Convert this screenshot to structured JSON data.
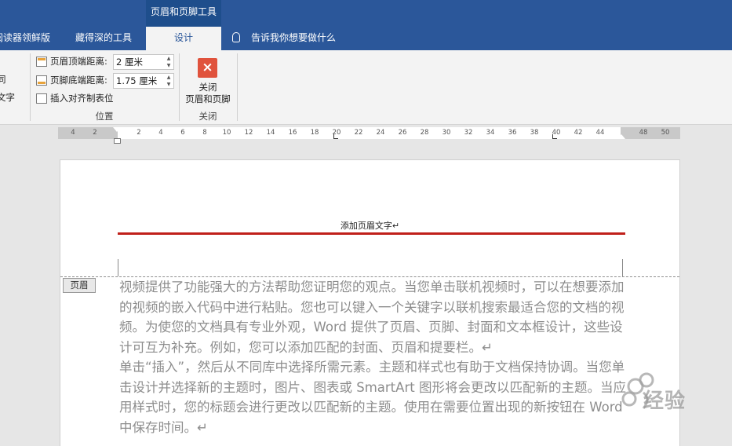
{
  "contextual_tab": {
    "label": "页眉和页脚工具"
  },
  "tabs": [
    {
      "label": "阅读器领鲜版"
    },
    {
      "label": "藏得深的工具"
    },
    {
      "label": "设计"
    }
  ],
  "tell_me": {
    "label": "告诉我你想要做什么"
  },
  "ribbon": {
    "left_partial": [
      "同",
      "文字"
    ],
    "position_group": {
      "header_top_label": "页眉顶端距离:",
      "header_top_value": "2 厘米",
      "footer_bottom_label": "页脚底端距离:",
      "footer_bottom_value": "1.75 厘米",
      "insert_align_tab_label": "插入对齐制表位",
      "group_label": "位置"
    },
    "close_group": {
      "button_line1": "关闭",
      "button_line2": "页眉和页脚",
      "group_label": "关闭"
    }
  },
  "ruler": {
    "left_ticks": [
      "4",
      "2"
    ],
    "right_ticks": [
      "2",
      "4",
      "6",
      "8",
      "10",
      "12",
      "14",
      "16",
      "18",
      "20",
      "22",
      "24",
      "26",
      "28",
      "30",
      "32",
      "34",
      "36",
      "38",
      "40",
      "42",
      "44"
    ],
    "overflow_ticks": [
      "48",
      "50"
    ]
  },
  "document": {
    "header_text": "添加页眉文字↵",
    "header_tag": "页眉",
    "header_rule_color": "#c0201a",
    "paragraphs": [
      "视频提供了功能强大的方法帮助您证明您的观点。当您单击联机视频时，可以在想要添加的视频的嵌入代码中进行粘贴。您也可以键入一个关键字以联机搜索最适合您的文档的视频。为使您的文档具有专业外观，Word 提供了页眉、页脚、封面和文本框设计，这些设计可互为补充。例如，您可以添加匹配的封面、页眉和提要栏。↵",
      "单击“插入”，然后从不同库中选择所需元素。主题和样式也有助于文档保持协调。当您单击设计并选择新的主题时，图片、图表或 SmartArt 图形将会更改以匹配新的主题。当应用样式时，您的标题会进行更改以匹配新的主题。使用在需要位置出现的新按钮在 Word 中保存时间。↵"
    ]
  },
  "watermark": {
    "text": "经验"
  },
  "colors": {
    "ribbon_blue": "#2b579a",
    "contextual_blue": "#1e4e8c",
    "close_icon": "#e0523c"
  }
}
